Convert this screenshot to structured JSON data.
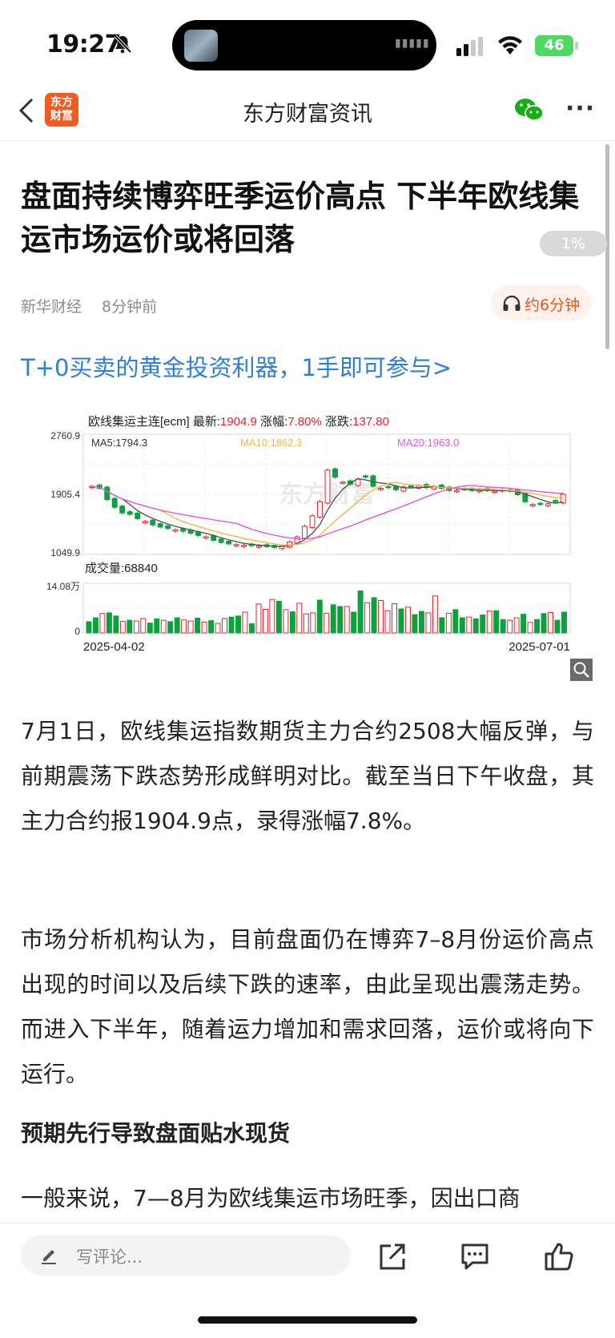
{
  "status_bar": {
    "time": "19:27",
    "battery": "46"
  },
  "nav": {
    "back_icon": "chevron-left-icon",
    "logo_text_line1": "东方",
    "logo_text_line2": "财富",
    "title": "东方财富资讯"
  },
  "article": {
    "title": "盘面持续博弈旺季运价高点 下半年欧线集运市场运价或将回落",
    "progress_badge": "1%",
    "source": "新华财经",
    "time_ago": "8分钟前",
    "listen_label": "约6分钟",
    "promo_link": "T+0买卖的黄金投资利器，1手即可参与>",
    "paragraphs": [
      "7月1日，欧线集运指数期货主力合约2508大幅反弹，与前期震荡下跌态势形成鲜明对比。截至当日下午收盘，其主力合约报1904.9点，录得涨幅7.8%。",
      "市场分析机构认为，目前盘面仍在博弈7–8月份运价高点出现的时间以及后续下跌的速率，由此呈现出震荡走势。而进入下半年，随着运力增加和需求回落，运价或将向下运行。"
    ],
    "subheading": "预期先行导致盘面贴水现货",
    "last_paragraph": "一般来说，7—8月为欧线集运市场旺季，因出口商"
  },
  "chart_data": {
    "type": "candlestick",
    "header": {
      "name": "欧线集运主连[ecm]",
      "latest_label": "最新:",
      "latest": "1904.9",
      "change_pct_label": "涨幅:",
      "change_pct": "7.80%",
      "change_label": "涨跌:",
      "change": "137.80"
    },
    "ma_labels": {
      "ma5": "MA5:1794.3",
      "ma10": "MA10:1862.3",
      "ma20": "MA20:1963.0"
    },
    "y_ticks": [
      "2760.9",
      "1905.4",
      "1049.9"
    ],
    "ylim": [
      1049.9,
      2760.9
    ],
    "volume_label": "成交量:68840",
    "volume_ticks": [
      "14.08万",
      "0"
    ],
    "x_labels": [
      "2025-04-02",
      "2025-07-01"
    ],
    "watermark": "东方财富",
    "closes": [
      2020,
      1990,
      1830,
      1720,
      1640,
      1620,
      1560,
      1520,
      1470,
      1440,
      1420,
      1400,
      1380,
      1350,
      1320,
      1300,
      1250,
      1220,
      1200,
      1190,
      1180,
      1175,
      1170,
      1160,
      1150,
      1170,
      1230,
      1300,
      1450,
      1600,
      1800,
      2250,
      2150,
      2080,
      2050,
      2120,
      2150,
      2020,
      1990,
      2000,
      1970,
      2010,
      2010,
      2030,
      2000,
      2020,
      1990,
      1960,
      1960,
      1970,
      1960,
      1970,
      1960,
      1950,
      1950,
      1950,
      1900,
      1800,
      1760,
      1760,
      1770,
      1800,
      1905
    ],
    "up_flags": [
      1,
      0,
      0,
      0,
      0,
      0,
      0,
      1,
      0,
      0,
      0,
      1,
      0,
      0,
      0,
      1,
      0,
      0,
      0,
      1,
      1,
      0,
      1,
      0,
      0,
      1,
      1,
      1,
      1,
      1,
      1,
      1,
      0,
      1,
      0,
      1,
      0,
      0,
      1,
      0,
      0,
      1,
      0,
      1,
      0,
      1,
      0,
      0,
      1,
      0,
      0,
      1,
      0,
      1,
      0,
      0,
      0,
      0,
      1,
      0,
      1,
      0,
      1
    ],
    "volumes": [
      3.2,
      4.3,
      5.5,
      5.7,
      4.8,
      3.3,
      3.6,
      3.4,
      4.1,
      2.8,
      4.0,
      3.6,
      3.2,
      4.3,
      3.7,
      3.4,
      4.2,
      3.1,
      3.5,
      2.7,
      4.1,
      4.5,
      4.8,
      5.9,
      2.6,
      8.2,
      6.7,
      9.5,
      9.0,
      6.6,
      6.0,
      8.4,
      5.4,
      5.7,
      9.3,
      5.6,
      8.0,
      7.5,
      7.5,
      5.9,
      11.9,
      8.6,
      10.0,
      9.2,
      6.3,
      8.3,
      6.8,
      7.3,
      5.2,
      6.1,
      5.7,
      10.5,
      4.3,
      5.6,
      6.6,
      4.3,
      4.5,
      4.0,
      5.1,
      6.2,
      6.3,
      3.8,
      3.6,
      4.3,
      5.3,
      3.0,
      3.8,
      5.5,
      5.8,
      3.6,
      5.9
    ],
    "series_colors": {
      "up": "#e8212c",
      "down": "#0aa23c",
      "ma5": "#555555",
      "ma10": "#f2b544",
      "ma20": "#e256e0"
    }
  },
  "bottom_bar": {
    "comment_placeholder": "写评论..."
  }
}
